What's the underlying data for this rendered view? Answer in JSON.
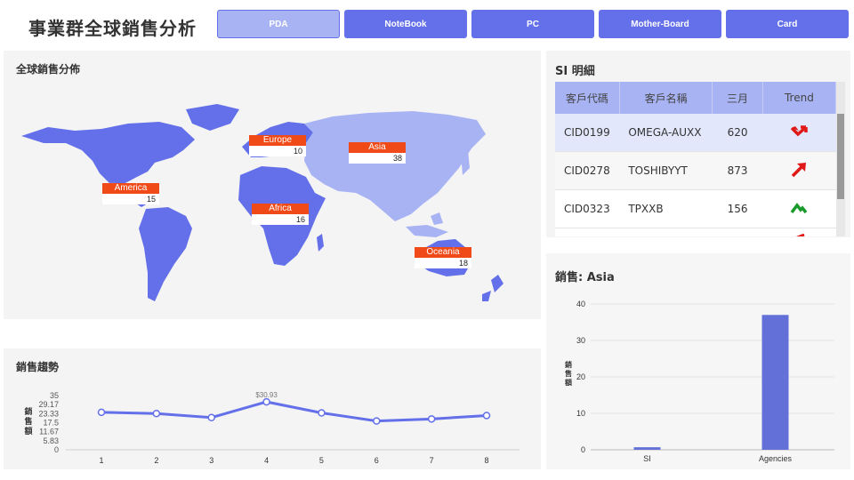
{
  "header": {
    "title": "事業群全球銷售分析",
    "tabs": [
      {
        "label": "PDA",
        "active": true
      },
      {
        "label": "NoteBook",
        "active": false
      },
      {
        "label": "PC",
        "active": false
      },
      {
        "label": "Mother-Board",
        "active": false
      },
      {
        "label": "Card",
        "active": false
      }
    ]
  },
  "map_panel": {
    "title": "全球銷售分佈",
    "markers": [
      {
        "name": "Europe",
        "value": "10"
      },
      {
        "name": "Asia",
        "value": "38"
      },
      {
        "name": "America",
        "value": "15"
      },
      {
        "name": "Africa",
        "value": "16"
      },
      {
        "name": "Oceania",
        "value": "18"
      }
    ],
    "colors": {
      "land": "#6370ea",
      "asia": "#a8b3f4",
      "marker": "#f04a18"
    }
  },
  "si_panel": {
    "title": "SI 明細",
    "columns": [
      "客戶代碼",
      "客戶名稱",
      "三月",
      "Trend"
    ],
    "rows": [
      {
        "code": "CID0199",
        "name": "OMEGA-AUXX",
        "march": "620",
        "trend": "down-arrow-icon",
        "color": "#e01818"
      },
      {
        "code": "CID0278",
        "name": "TOSHIBYYT",
        "march": "873",
        "trend": "up-arrow-icon",
        "color": "#e01818"
      },
      {
        "code": "CID0323",
        "name": "TPXXB",
        "march": "156",
        "trend": "up-bounce-icon",
        "color": "#1a9a2a"
      }
    ]
  },
  "trend_panel": {
    "title": "銷售趨勢",
    "peak_label": "$30.93"
  },
  "asia_panel": {
    "title": "銷售: Asia"
  },
  "chart_data": [
    {
      "type": "line",
      "title": "銷售趨勢",
      "ylabel": "銷售額",
      "x": [
        1,
        2,
        3,
        4,
        5,
        6,
        7,
        8
      ],
      "series": [
        {
          "values": [
            24.2,
            23.4,
            20.8,
            30.93,
            23.8,
            18.6,
            19.9,
            22.1
          ]
        }
      ],
      "yticks": [
        "0",
        "5.83",
        "11.67",
        "17.5",
        "23.33",
        "29.17",
        "35"
      ],
      "ylim": [
        0,
        35
      ],
      "annotations": [
        "$30.93"
      ],
      "color": "#6370ea"
    },
    {
      "type": "bar",
      "title": "銷售: Asia",
      "ylabel": "銷售額",
      "categories": [
        "SI",
        "Agencies"
      ],
      "values": [
        0.7,
        37
      ],
      "yticks": [
        "0",
        "10",
        "20",
        "30",
        "40"
      ],
      "ylim": [
        0,
        40
      ],
      "color": "#6370d8"
    }
  ]
}
